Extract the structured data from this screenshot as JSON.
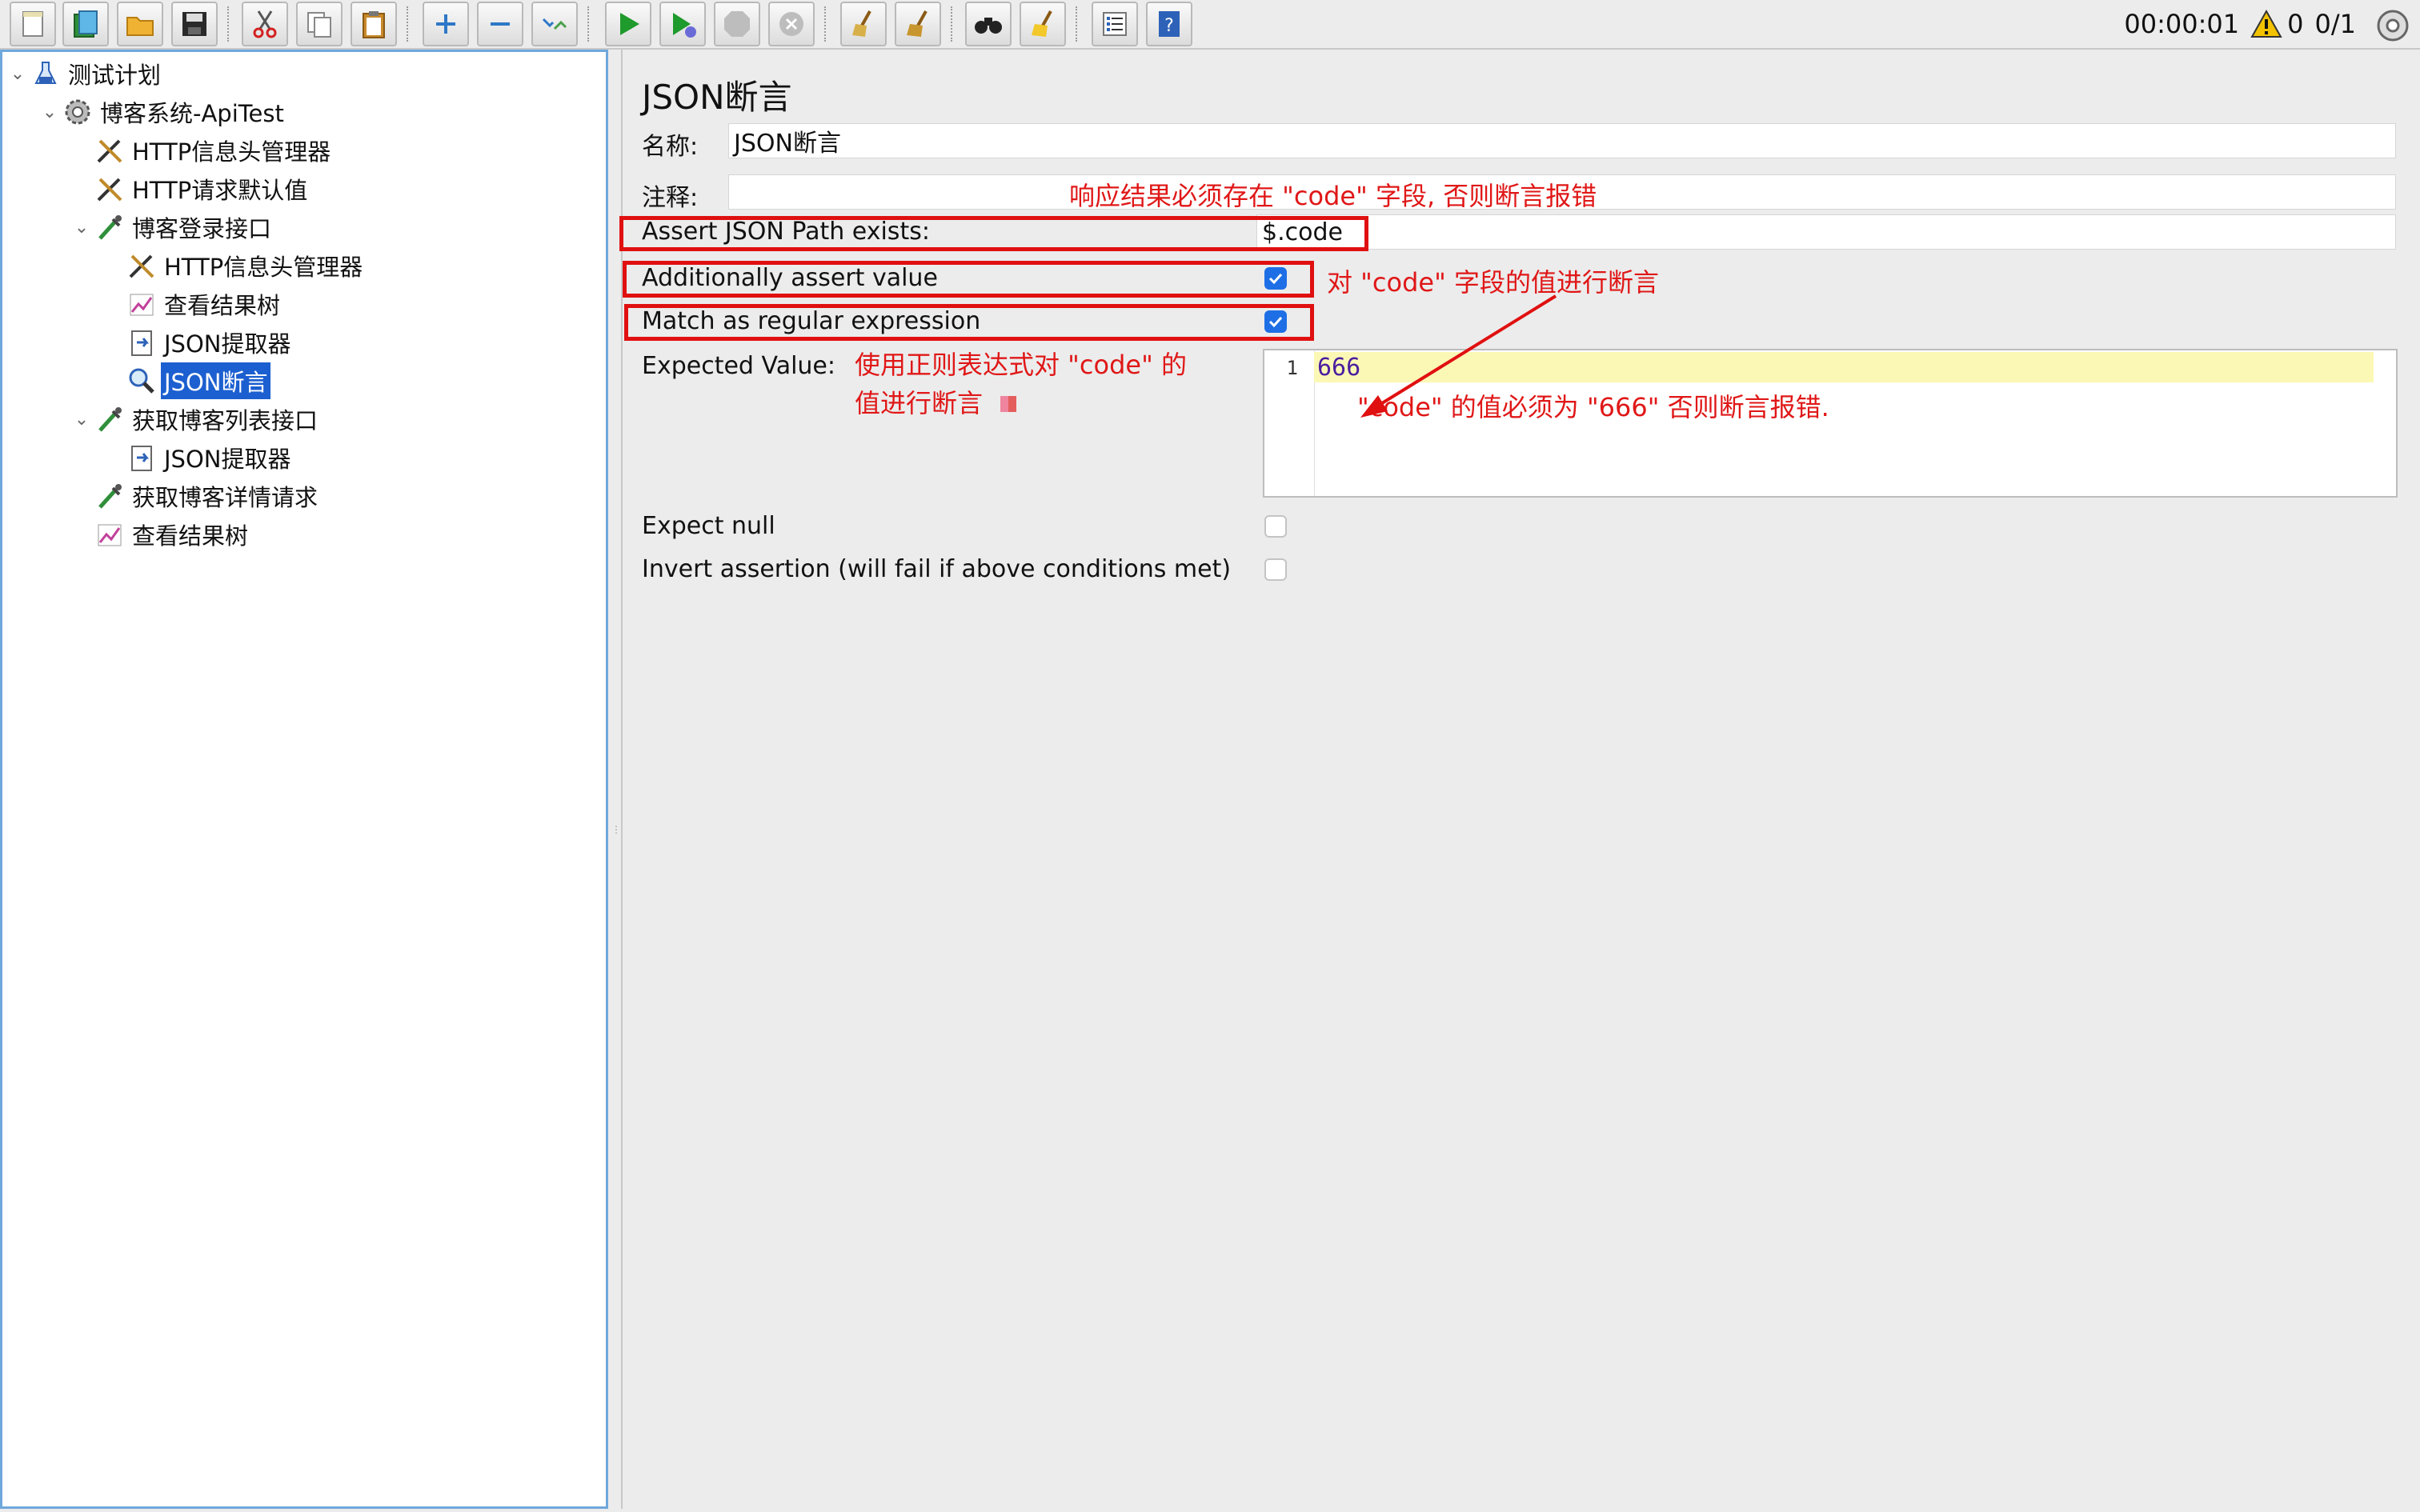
{
  "toolbar": {
    "buttons": [
      {
        "name": "new-button",
        "icon": "new-file-icon"
      },
      {
        "name": "templates-button",
        "icon": "templates-icon"
      },
      {
        "name": "open-button",
        "icon": "open-folder-icon"
      },
      {
        "name": "save-button",
        "icon": "save-icon"
      },
      {
        "name": "cut-button",
        "icon": "cut-icon"
      },
      {
        "name": "copy-button",
        "icon": "copy-icon"
      },
      {
        "name": "paste-button",
        "icon": "paste-icon"
      },
      {
        "name": "expand-button",
        "icon": "plus-icon"
      },
      {
        "name": "collapse-button",
        "icon": "minus-icon"
      },
      {
        "name": "toggle-button",
        "icon": "toggle-icon"
      },
      {
        "name": "start-button",
        "icon": "play-icon"
      },
      {
        "name": "start-no-pause-button",
        "icon": "play-timer-icon"
      },
      {
        "name": "stop-button",
        "icon": "stop-icon"
      },
      {
        "name": "shutdown-button",
        "icon": "shutdown-icon"
      },
      {
        "name": "clear-button",
        "icon": "broom-icon"
      },
      {
        "name": "clear-all-button",
        "icon": "broom-all-icon"
      },
      {
        "name": "search-button",
        "icon": "binoculars-icon"
      },
      {
        "name": "reset-search-button",
        "icon": "reset-broom-icon"
      },
      {
        "name": "function-helper-button",
        "icon": "list-icon"
      },
      {
        "name": "help-button",
        "icon": "help-icon"
      }
    ]
  },
  "status": {
    "timer": "00:00:01",
    "warnings": "0",
    "threads": "0/1"
  },
  "tree": {
    "items": [
      {
        "label": "测试计划",
        "icon": "test-plan-flask-icon",
        "expanded": true
      },
      {
        "label": "博客系统-ApiTest",
        "icon": "thread-group-gear-icon",
        "expanded": true
      },
      {
        "label": "HTTP信息头管理器",
        "icon": "config-tools-icon"
      },
      {
        "label": "HTTP请求默认值",
        "icon": "config-tools-icon"
      },
      {
        "label": "博客登录接口",
        "icon": "sampler-pipette-icon",
        "expanded": true
      },
      {
        "label": "HTTP信息头管理器",
        "icon": "config-tools-icon"
      },
      {
        "label": "查看结果树",
        "icon": "listener-graph-icon"
      },
      {
        "label": "JSON提取器",
        "icon": "post-processor-icon"
      },
      {
        "label": "JSON断言",
        "icon": "assertion-magnifier-icon",
        "selected": true
      },
      {
        "label": "获取博客列表接口",
        "icon": "sampler-pipette-icon",
        "expanded": true
      },
      {
        "label": "JSON提取器",
        "icon": "post-processor-icon"
      },
      {
        "label": "获取博客详情请求",
        "icon": "sampler-pipette-icon"
      },
      {
        "label": "查看结果树",
        "icon": "listener-graph-icon"
      }
    ]
  },
  "panel": {
    "title": "JSON断言",
    "name_label": "名称:",
    "name_value": "JSON断言",
    "comment_label": "注释:",
    "assert_path_label": "Assert JSON Path exists:",
    "assert_path_value": "$.code",
    "additionally_assert_label": "Additionally assert value",
    "additionally_assert_checked": true,
    "match_regex_label": "Match as regular expression",
    "match_regex_checked": true,
    "expected_value_label": "Expected Value:",
    "expected_value_line_number": "1",
    "expected_value": "666",
    "expect_null_label": "Expect null",
    "expect_null_checked": false,
    "invert_label": "Invert assertion (will fail if above conditions met)",
    "invert_checked": false
  },
  "annotations": {
    "comment_note": "响应结果必须存在 \"code\" 字段, 否则断言报错",
    "additionally_note": "对 \"code\" 字段的值进行断言",
    "regex_note_line1": "使用正则表达式对 \"code\" 的",
    "regex_note_line2": "值进行断言",
    "expected_note": "\"code\" 的值必须为 \"666\" 否则断言报错.",
    "annotation_color": "#e01717"
  }
}
